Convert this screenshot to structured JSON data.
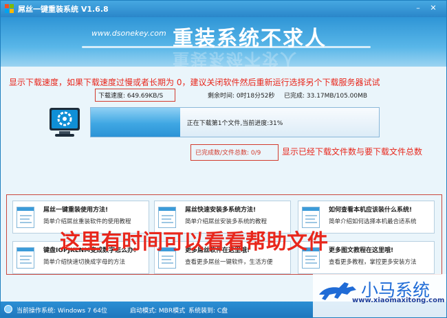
{
  "window": {
    "title": "屌丝一键重装系统 V1.6.8"
  },
  "banner": {
    "site": "www.dsonekey.com",
    "slogan": "重装系统不求人"
  },
  "annotations": {
    "top_hint": "显示下载速度，如果下载速度过慢或者长期为 0，建议关闭软件然后重新运行选择另个下载服务器试试",
    "right_hint": "显示已经下载文件数与要下载文件总数",
    "help_overlay": "这里有时间可以看看帮助文件"
  },
  "download": {
    "speed": "下载速度: 649.69KB/S",
    "remaining": "剩余时间: 0时18分52秒",
    "completed": "已完成: 33.17MB/105.00MB",
    "progress_percent": 31,
    "progress_text": "正在下载第1个文件,当前进度:31%",
    "file_count": "已完成数/文件总数: 0/9"
  },
  "help_cards": [
    {
      "title": "屌丝一键重装使用方法!",
      "desc": "简单介绍屌丝重装软件的使用教程"
    },
    {
      "title": "屌丝快速安装多系统方法!",
      "desc": "简单介绍屌丝安装多系统的教程"
    },
    {
      "title": "如何查看本机应该装什么系统!",
      "desc": "简单介绍如何选择本机最合适系统"
    },
    {
      "title": "键盘IOPJKLNM变成数字怎么办!",
      "desc": "简单介绍快速切换成字母的方法"
    },
    {
      "title": "更多屌丝软件在这里哦!",
      "desc": "查看更多屌丝一键软件，生活方便"
    },
    {
      "title": "更多图文教程在这里哦!",
      "desc": "查看更多教程，掌控更多安装方法"
    }
  ],
  "status": {
    "os": "当前操作系统: Windows 7 64位",
    "boot": "启动模式: MBR模式",
    "install_to": "系统装到: C盘"
  },
  "watermark": {
    "brand": "小马系统",
    "url": "www.xiaomaxitong.com"
  },
  "colors": {
    "accent": "#2a86c9",
    "annotation_red": "#e8271c"
  }
}
